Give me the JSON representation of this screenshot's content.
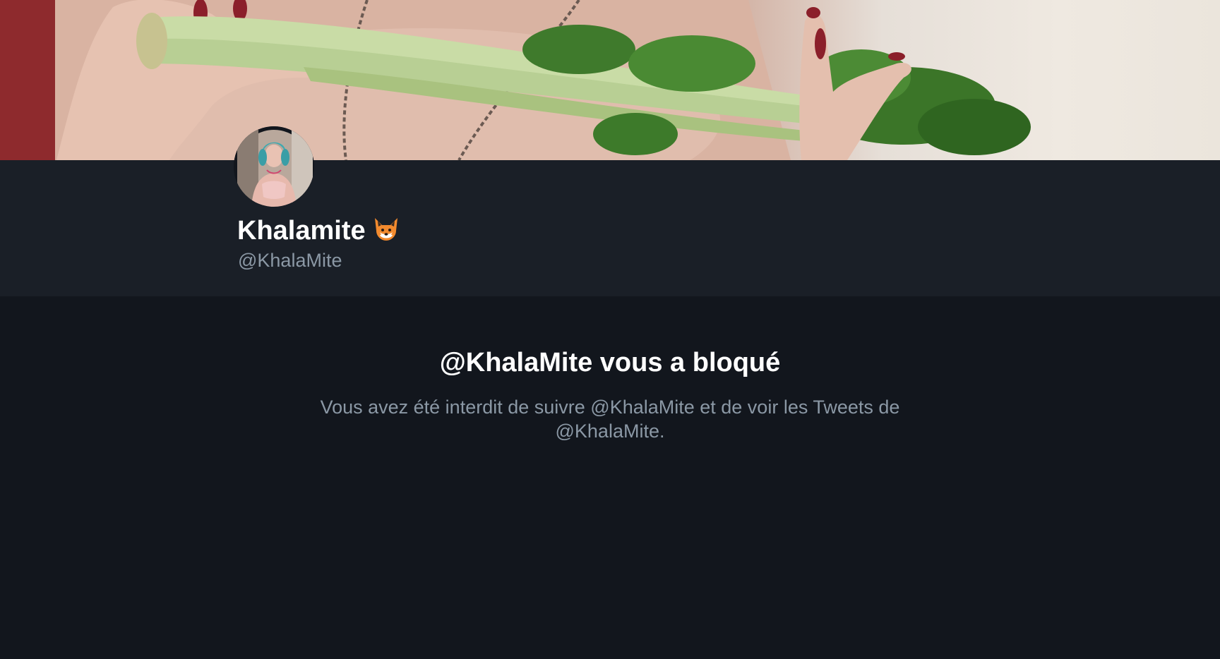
{
  "profile": {
    "display_name": "Khalamite",
    "handle": "@KhalaMite",
    "name_emoji": "fox-face-icon"
  },
  "blocked_notice": {
    "title": "@KhalaMite vous a bloqué",
    "description": "Vous avez été interdit de suivre @KhalaMite et de voir les Tweets de @KhalaMite."
  },
  "colors": {
    "background": "#12161d",
    "profile_strip": "#1a1f27",
    "primary_text": "#ffffff",
    "secondary_text": "#8b98a5"
  }
}
